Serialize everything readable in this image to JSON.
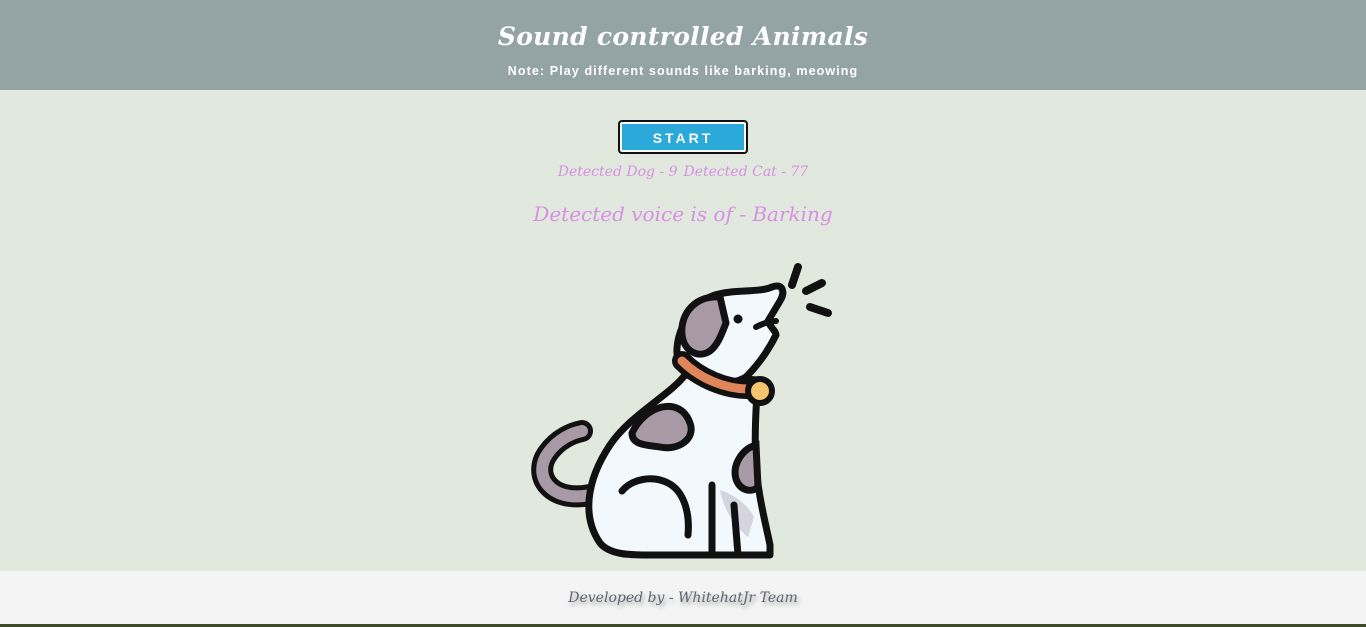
{
  "header": {
    "title": "Sound controlled Animals",
    "note": "Note: Play different sounds like barking, meowing"
  },
  "controls": {
    "start_label": "START"
  },
  "counts": {
    "dog": "Detected Dog - 9",
    "cat": "Detected Cat - 77"
  },
  "result": {
    "text": "Detected voice is of - Barking"
  },
  "image": {
    "icon": "barking-dog-icon"
  },
  "footer": {
    "credit": "Developed by - WhitehatJr Team"
  },
  "colors": {
    "header_bg": "#94a4a5",
    "page_bg": "#e1e8de",
    "button_bg": "#2ba9d9",
    "accent_text": "#d98fe6",
    "footer_bg": "#f4f4f4"
  }
}
